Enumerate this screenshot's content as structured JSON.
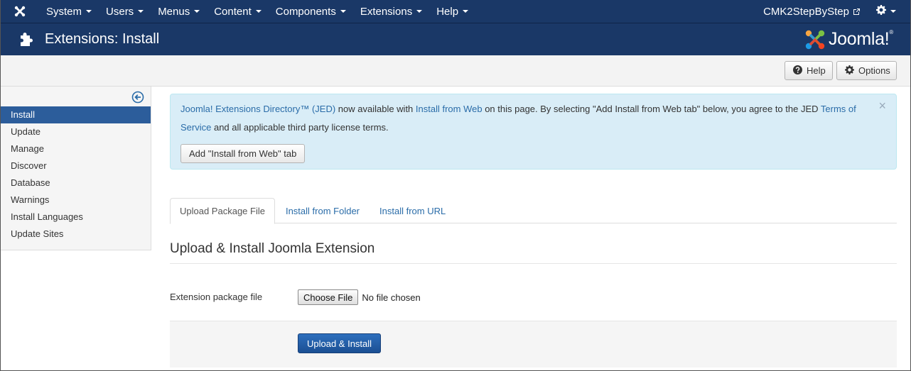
{
  "navbar": {
    "logo_icon": "joomla-icon",
    "menus": [
      "System",
      "Users",
      "Menus",
      "Content",
      "Components",
      "Extensions",
      "Help"
    ],
    "site_name": "CMK2StepByStep",
    "site_link_icon": "external-link-icon",
    "user_menu_icon": "gear-icon"
  },
  "header": {
    "icon": "puzzle-icon",
    "title": "Extensions: Install",
    "brand": "Joomla!",
    "brand_mark": "®"
  },
  "toolbar": {
    "help_label": "Help",
    "options_label": "Options"
  },
  "sidebar": {
    "collapse_icon": "circle-arrow-left-icon",
    "items": [
      {
        "label": "Install",
        "active": true
      },
      {
        "label": "Update"
      },
      {
        "label": "Manage"
      },
      {
        "label": "Discover"
      },
      {
        "label": "Database"
      },
      {
        "label": "Warnings"
      },
      {
        "label": "Install Languages"
      },
      {
        "label": "Update Sites"
      }
    ]
  },
  "alert": {
    "jed_link": "Joomla! Extensions Directory™ (JED)",
    "text1": " now available with ",
    "install_web_link": "Install from Web",
    "text2": " on this page.  By selecting \"Add Install from Web tab\" below, you agree to the JED ",
    "terms_link": "Terms of Service",
    "text3": " and all applicable third party license terms.",
    "button_label": "Add \"Install from Web\" tab",
    "close_symbol": "×"
  },
  "tabs": [
    {
      "label": "Upload Package File",
      "active": true
    },
    {
      "label": "Install from Folder"
    },
    {
      "label": "Install from URL"
    }
  ],
  "upload": {
    "section_title": "Upload & Install Joomla Extension",
    "field_label": "Extension package file",
    "choose_label": "Choose File",
    "no_file_text": "No file chosen",
    "submit_label": "Upload & Install"
  }
}
